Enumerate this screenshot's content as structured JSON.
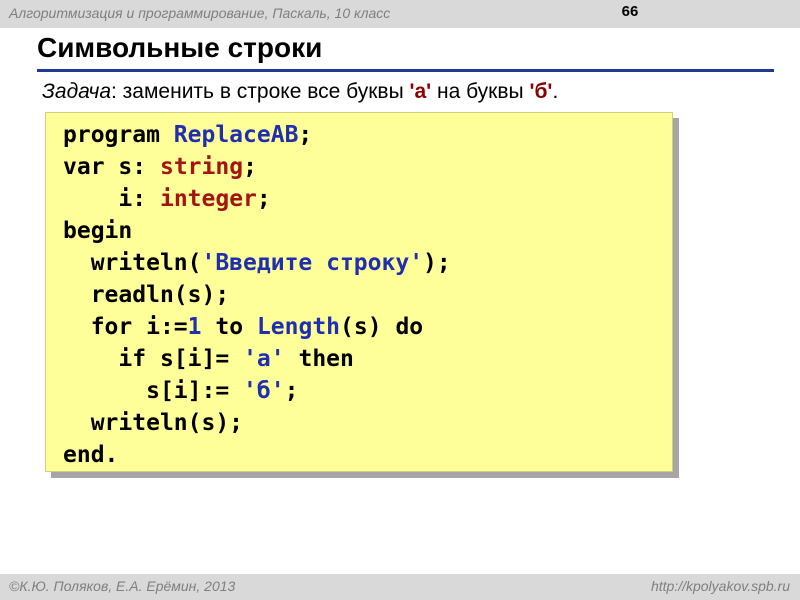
{
  "header": {
    "course_title": "Алгоритмизация и программирование, Паскаль, 10 класс",
    "slide_number": "66"
  },
  "title": "Символьные строки",
  "task": {
    "label": "Задача",
    "text_before": ": заменить в строке все буквы ",
    "char_from": "'а'",
    "text_middle": " на буквы ",
    "char_to": "'б'",
    "text_end": "."
  },
  "code": {
    "l1": {
      "kw": "program",
      "name": "ReplaceAB",
      "end": ";"
    },
    "l2": {
      "kw": "var",
      "id": "s",
      "sep": ":",
      "type": "string",
      "end": ";"
    },
    "l3": {
      "id": "i",
      "sep": ":",
      "type": "integer",
      "end": ";"
    },
    "l4": {
      "kw": "begin"
    },
    "l5": {
      "fn": "writeln(",
      "str": "'Введите строку'",
      "end": ");"
    },
    "l6": {
      "text": "readln(s);"
    },
    "l7": {
      "kw_for": "for",
      "var": "i:=",
      "num": "1",
      "kw_to": "to",
      "fn": "Length",
      "args": "(s)",
      "kw_do": "do"
    },
    "l8": {
      "kw_if": "if",
      "expr": "s[i]=",
      "str": "'а'",
      "kw_then": "then"
    },
    "l9": {
      "expr": "s[i]:=",
      "str": "'б'",
      "end": ";"
    },
    "l10": {
      "text": "writeln(s);"
    },
    "l11": {
      "kw": "end."
    }
  },
  "footer": {
    "authors": "©К.Ю. Поляков, Е.А. Ерёмин, 2013",
    "url": "http://kpolyakov.spb.ru"
  },
  "colors": {
    "code_background": "#ffff99",
    "keyword": "#000000",
    "identifier_blue": "#1f2fb0",
    "type_red": "#a31515",
    "title_rule": "#1f3a93"
  }
}
